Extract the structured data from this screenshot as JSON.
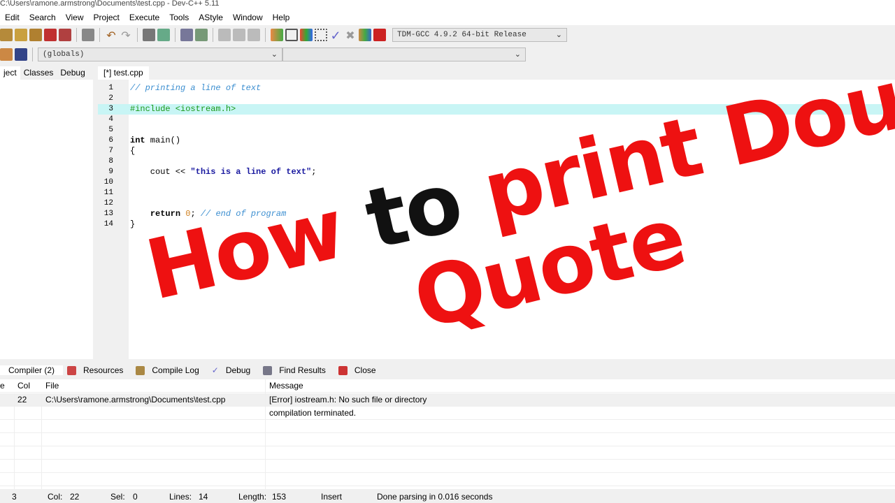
{
  "window": {
    "title": "C:\\Users\\ramone.armstrong\\Documents\\test.cpp - Dev-C++ 5.11"
  },
  "menu": [
    "Edit",
    "Search",
    "View",
    "Project",
    "Execute",
    "Tools",
    "AStyle",
    "Window",
    "Help"
  ],
  "toolbar": {
    "compiler": "TDM-GCC 4.9.2 64-bit Release",
    "scope": "(globals)",
    "member": ""
  },
  "left_tabs": [
    "ject",
    "Classes",
    "Debug"
  ],
  "editor_tab": "[*] test.cpp",
  "code_lines": [
    {
      "n": "1",
      "html": "<span class='cmt'>// printing a line of text</span>"
    },
    {
      "n": "2",
      "html": ""
    },
    {
      "n": "3",
      "html": "<span class='pp'>#include &lt;iostream.h&gt;</span>"
    },
    {
      "n": "4",
      "html": ""
    },
    {
      "n": "5",
      "html": ""
    },
    {
      "n": "6",
      "html": "<span class='kw'>int</span> main()"
    },
    {
      "n": "7",
      "html": "{"
    },
    {
      "n": "8",
      "html": ""
    },
    {
      "n": "9",
      "html": "    cout &lt;&lt; <span class='str'>\"this is a line of text\"</span>;"
    },
    {
      "n": "10",
      "html": ""
    },
    {
      "n": "11",
      "html": ""
    },
    {
      "n": "12",
      "html": ""
    },
    {
      "n": "13",
      "html": "    <span class='kw'>return</span> <span class='num'>0</span>; <span class='cmt'>// end of program</span>"
    },
    {
      "n": "14",
      "html": "}"
    }
  ],
  "highlight_line": 3,
  "bottom_tabs": [
    "Compiler (2)",
    "Resources",
    "Compile Log",
    "Debug",
    "Find Results",
    "Close"
  ],
  "messages": {
    "headers": [
      "e",
      "Col",
      "File",
      "Message"
    ],
    "rows": [
      [
        "",
        "22",
        "C:\\Users\\ramone.armstrong\\Documents\\test.cpp",
        "[Error] iostream.h: No such file or directory"
      ],
      [
        "",
        "",
        "",
        "compilation terminated."
      ]
    ]
  },
  "status": {
    "line": "3",
    "col_label": "Col:",
    "col": "22",
    "sel_label": "Sel:",
    "sel": "0",
    "lines_label": "Lines:",
    "lines": "14",
    "length_label": "Length:",
    "length": "153",
    "mode": "Insert",
    "parse": "Done parsing in 0.016 seconds"
  },
  "overlay": {
    "w1": "How",
    "w2": "to",
    "w3": "print Double",
    "w4": "Quote"
  },
  "colors": {
    "overlay_red": "#ee1111",
    "highlight": "#c8f5f5"
  }
}
